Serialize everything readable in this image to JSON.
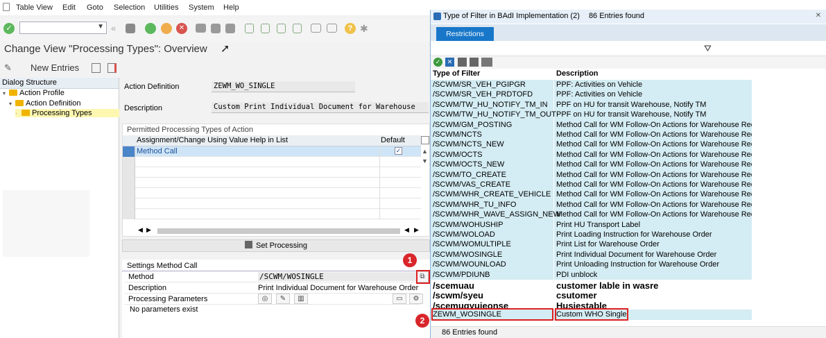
{
  "menubar": [
    "Table View",
    "Edit",
    "Goto",
    "Selection",
    "Utilities",
    "System",
    "Help"
  ],
  "page_title": "Change View \"Processing Types\": Overview",
  "appbar": {
    "new_entries": "New Entries"
  },
  "tree": {
    "header": "Dialog Structure",
    "nodes": [
      "Action Profile",
      "Action Definition",
      "Processing Types"
    ]
  },
  "form": {
    "action_definition_label": "Action Definition",
    "action_definition_value": "ZEWM_WO_SINGLE",
    "description_label": "Description",
    "description_value": "Custom Print Individual Document for Warehouse"
  },
  "table": {
    "title": "Permitted Processing Types of Action",
    "col_assign": "Assignment/Change Using Value Help in List",
    "col_default": "Default",
    "rows": [
      {
        "value": "Method Call",
        "default": "✓"
      }
    ]
  },
  "set_processing": "Set Processing",
  "settings": {
    "title": "Settings Method Call",
    "method_label": "Method",
    "method_value": "/SCWM/WOSINGLE",
    "description_label": "Description",
    "description_value": "Print Individual Document for Warehouse Order",
    "params_label": "Processing Parameters",
    "no_params": "No parameters exist"
  },
  "badges": [
    "1",
    "2"
  ],
  "dialog": {
    "title": "Type of Filter in BAdI Implementation (2)",
    "count": "86 Entries found",
    "tab": "Restrictions",
    "col_filter": "Type of Filter",
    "col_desc": "Description",
    "rows": [
      {
        "k": "/SCWM/SR_VEH_PGIPGR",
        "d": "PPF: Activities on Vehicle"
      },
      {
        "k": "/SCWM/SR_VEH_PRDTOFD",
        "d": "PPF: Activities on Vehicle"
      },
      {
        "k": "/SCWM/TW_HU_NOTIFY_TM_IN",
        "d": "PPF on HU for transit Warehouse, Notify TM"
      },
      {
        "k": "/SCWM/TW_HU_NOTIFY_TM_OUT",
        "d": "PPF on HU for transit Warehouse, Notify TM"
      },
      {
        "k": "/SCWM/GM_POSTING",
        "d": "Method Call for WM Follow-On Actions for Warehouse Request"
      },
      {
        "k": "/SCWM/NCTS",
        "d": "Method Call for WM Follow-On Actions for Warehouse Request"
      },
      {
        "k": "/SCWM/NCTS_NEW",
        "d": "Method Call for WM Follow-On Actions for Warehouse Request"
      },
      {
        "k": "/SCWM/OCTS",
        "d": "Method Call for WM Follow-On Actions for Warehouse Request"
      },
      {
        "k": "/SCWM/OCTS_NEW",
        "d": "Method Call for WM Follow-On Actions for Warehouse Request"
      },
      {
        "k": "/SCWM/TO_CREATE",
        "d": "Method Call for WM Follow-On Actions for Warehouse Request"
      },
      {
        "k": "/SCWM/VAS_CREATE",
        "d": "Method Call for WM Follow-On Actions for Warehouse Request"
      },
      {
        "k": "/SCWM/WHR_CREATE_VEHICLE",
        "d": "Method Call for WM Follow-On Actions for Warehouse Request"
      },
      {
        "k": "/SCWM/WHR_TU_INFO",
        "d": "Method Call for WM Follow-On Actions for Warehouse Request"
      },
      {
        "k": "/SCWM/WHR_WAVE_ASSIGN_NEW",
        "d": "Method Call for WM Follow-On Actions for Warehouse Request"
      },
      {
        "k": "/SCWM/WOHUSHIP",
        "d": "Print HU Transport Label"
      },
      {
        "k": "/SCWM/WOLOAD",
        "d": "Print Loading Instruction for Warehouse Order"
      },
      {
        "k": "/SCWM/WOMULTIPLE",
        "d": "Print List for Warehouse Order"
      },
      {
        "k": "/SCWM/WOSINGLE",
        "d": "Print Individual Document for Warehouse Order"
      },
      {
        "k": "/SCWM/WOUNLOAD",
        "d": "Print Unloading Instruction for Warehouse Order"
      },
      {
        "k": "/SCWM/PDIUNB",
        "d": "PDI unblock"
      },
      {
        "k": "/scemuau",
        "d": "customer lable in wasre"
      },
      {
        "k": "/scwm/syeu",
        "d": "csutomer"
      },
      {
        "k": "/scemuqyuieonse",
        "d": "Husiestable"
      },
      {
        "k": "ZEWM_WOSINGLE",
        "d": "Custom WHO Single"
      }
    ]
  }
}
